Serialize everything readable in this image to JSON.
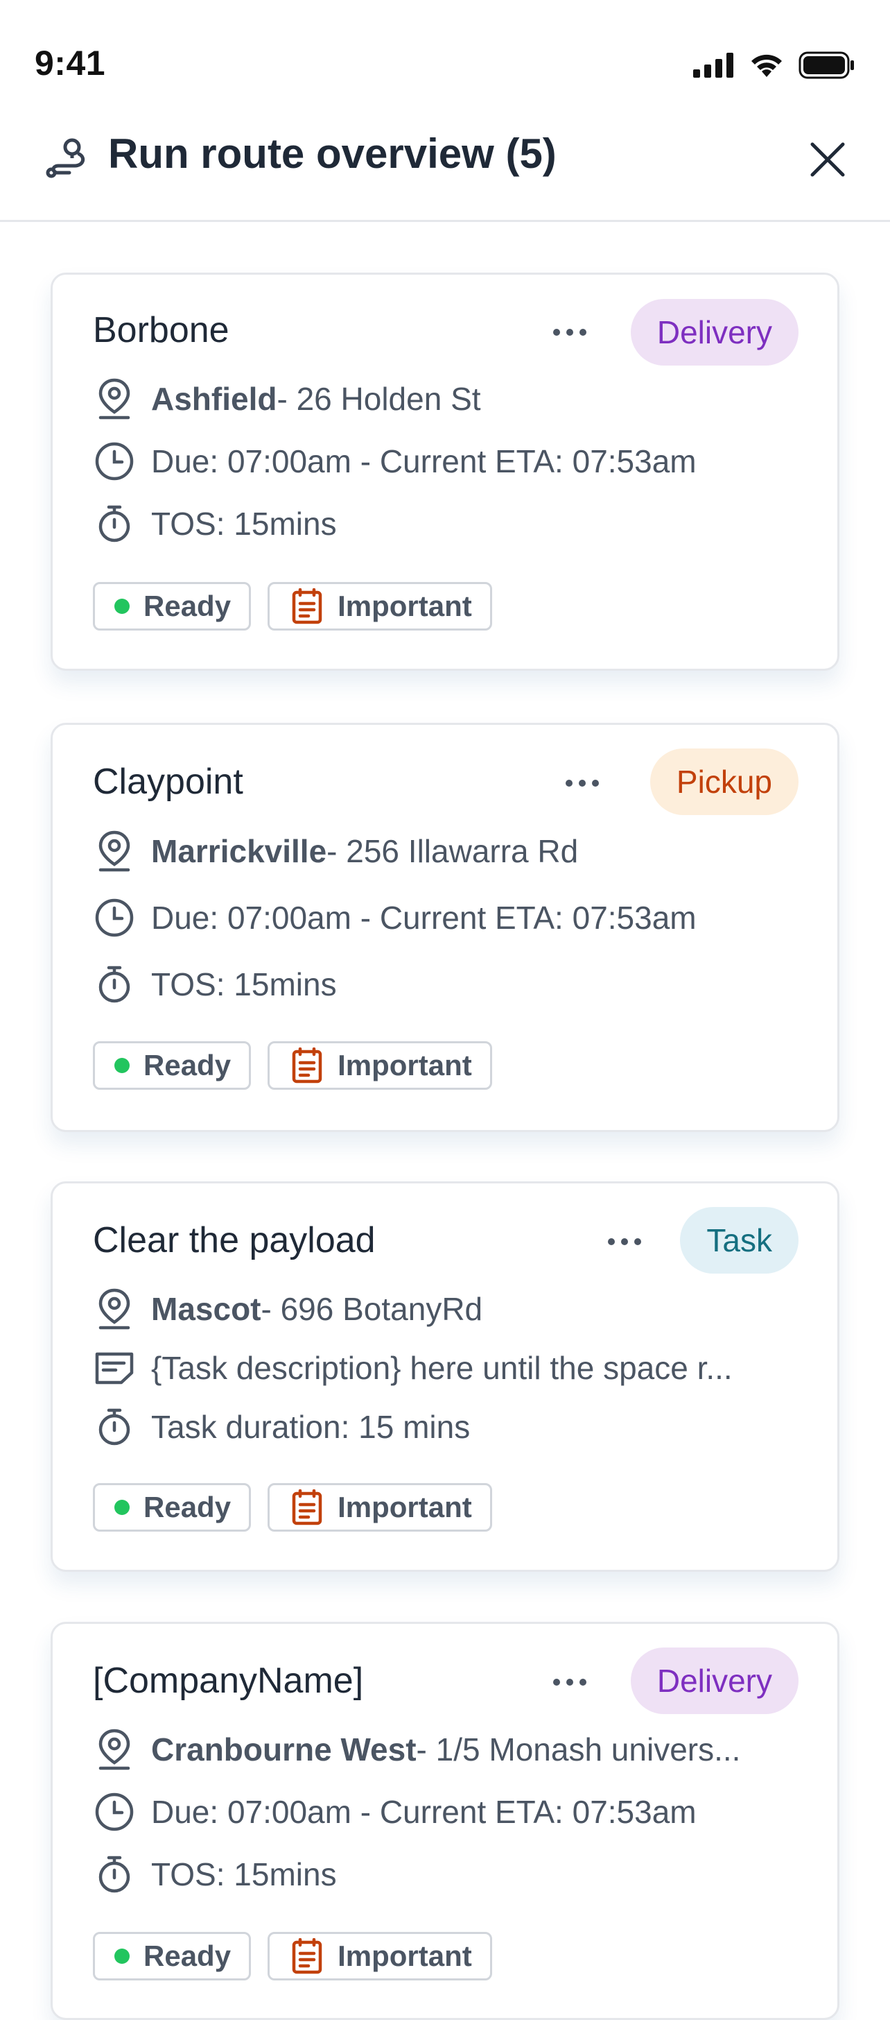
{
  "status_bar": {
    "time": "9:41"
  },
  "header": {
    "title": "Run route overview (5)"
  },
  "colors": {
    "delivery_bg": "#efe1f5",
    "delivery_fg": "#7e2fc0",
    "pickup_bg": "#fdeedb",
    "pickup_fg": "#c2410c",
    "task_bg": "#e1f0f6",
    "task_fg": "#156f80",
    "ready_dot": "#22c55e",
    "important_icon": "#c2410c"
  },
  "stops": [
    {
      "name": "Borbone",
      "type": "Delivery",
      "suburb": "Ashfield",
      "address": " - 26 Holden St",
      "time_line": "Due: 07:00am - Current ETA: 07:53am",
      "duration": "TOS: 15mins",
      "status": "Ready",
      "flag": "Important"
    },
    {
      "name": "Claypoint",
      "type": "Pickup",
      "suburb": "Marrickville",
      "address": " - 256 Illawarra Rd",
      "time_line": "Due: 07:00am - Current ETA: 07:53am",
      "duration": "TOS: 15mins",
      "status": "Ready",
      "flag": "Important"
    },
    {
      "name": "Clear the payload",
      "type": "Task",
      "suburb": "Mascot",
      "address": " - 696 BotanyRd",
      "description": "{Task description} here until the space r...",
      "duration": "Task duration: 15 mins",
      "status": "Ready",
      "flag": "Important"
    },
    {
      "name": "[CompanyName]",
      "type": "Delivery",
      "suburb": "Cranbourne West",
      "address": " - 1/5 Monash univers...",
      "time_line": "Due: 07:00am - Current ETA: 07:53am",
      "duration": "TOS: 15mins",
      "status": "Ready",
      "flag": "Important"
    }
  ]
}
